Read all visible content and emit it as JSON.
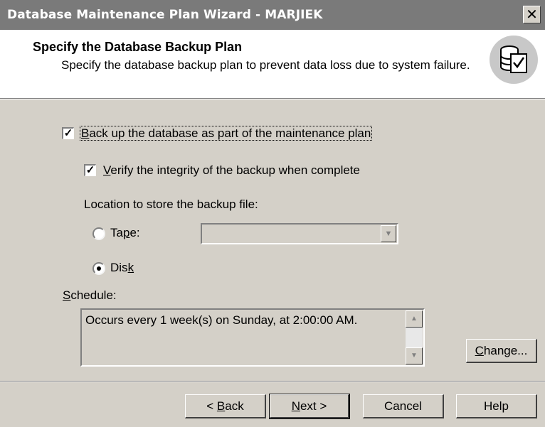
{
  "window": {
    "title": "Database Maintenance Plan Wizard - MARJIEK",
    "close_glyph": "✕"
  },
  "header": {
    "title": "Specify the Database Backup Plan",
    "subtitle": "Specify the database backup plan to prevent data loss due to system failure.",
    "icon": "database-checklist-icon"
  },
  "form": {
    "backup_checkbox": {
      "checked": true,
      "pre": "",
      "key": "B",
      "post": "ack up the database as part of the maintenance plan"
    },
    "verify_checkbox": {
      "checked": true,
      "pre": "",
      "key": "V",
      "post": "erify the integrity of the backup when complete"
    },
    "location_label": "Location to store the backup file:",
    "tape_radio": {
      "selected": false,
      "pre": "Ta",
      "key": "p",
      "post": "e:"
    },
    "tape_combo": {
      "value": "",
      "enabled": false
    },
    "disk_radio": {
      "selected": true,
      "pre": "Dis",
      "key": "k",
      "post": ""
    },
    "schedule_label": {
      "pre": "",
      "key": "S",
      "post": "chedule:"
    },
    "schedule_text": "Occurs every 1 week(s) on Sunday, at 2:00:00 AM."
  },
  "buttons": {
    "change": {
      "pre": "",
      "key": "C",
      "post": "hange..."
    },
    "back": {
      "pre": "< ",
      "key": "B",
      "post": "ack"
    },
    "next": {
      "pre": "",
      "key": "N",
      "post": "ext >"
    },
    "cancel": "Cancel",
    "help": "Help"
  },
  "colors": {
    "titlebar": "#7a7a7a",
    "dialog_face": "#d4d0c8",
    "header_bg": "#ffffff"
  }
}
